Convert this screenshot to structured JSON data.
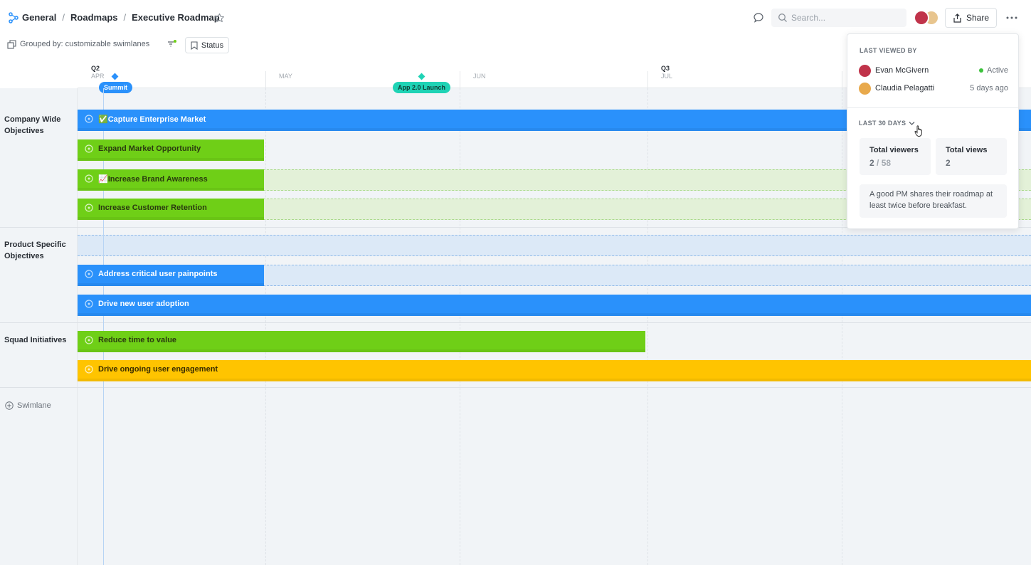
{
  "header": {
    "breadcrumbs": [
      "General",
      "Roadmaps",
      "Executive Roadmap"
    ],
    "search_placeholder": "Search...",
    "share_label": "Share"
  },
  "toolbar": {
    "grouped_label": "Grouped by: customizable swimlanes",
    "status_label": "Status"
  },
  "timeline": {
    "quarters": [
      "Q2",
      "Q3"
    ],
    "months": [
      "APR",
      "MAY",
      "JUN",
      "JUL"
    ],
    "milestones": [
      {
        "label": "Summit",
        "color": "#2a91fb"
      },
      {
        "label": "App 2.0 Launch",
        "color": "#1fd3b5"
      }
    ],
    "lanes": [
      "Company Wide Objectives",
      "Product Specific Objectives",
      "Squad Initiatives"
    ],
    "bars": [
      {
        "label": "✅Capture Enterprise Market",
        "color": "blue"
      },
      {
        "label": "Expand Market Opportunity",
        "color": "green"
      },
      {
        "label": "📈Increase Brand Awareness",
        "color": "green"
      },
      {
        "label": "Increase Customer Retention",
        "color": "green"
      },
      {
        "label": "Address critical user painpoints",
        "color": "blue"
      },
      {
        "label": "Drive new user adoption",
        "color": "blue"
      },
      {
        "label": "Reduce time to value",
        "color": "green"
      },
      {
        "label": "Drive ongoing user engagement",
        "color": "yellow"
      }
    ],
    "add_swimlane_label": "Swimlane"
  },
  "popover": {
    "title": "LAST VIEWED BY",
    "viewers": [
      {
        "name": "Evan McGivern",
        "status": "Active"
      },
      {
        "name": "Claudia Pelagatti",
        "status": "5 days ago"
      }
    ],
    "range_label": "LAST 30 DAYS",
    "stats": {
      "viewers_label": "Total viewers",
      "viewers_value": "2",
      "viewers_total": "/ 58",
      "views_label": "Total views",
      "views_value": "2"
    },
    "tip": "A good PM shares their roadmap at least twice before breakfast."
  },
  "colors": {
    "blue": "#2a91fb",
    "green": "#6fcf17",
    "yellow": "#ffc400",
    "teal": "#1fd3b5"
  }
}
